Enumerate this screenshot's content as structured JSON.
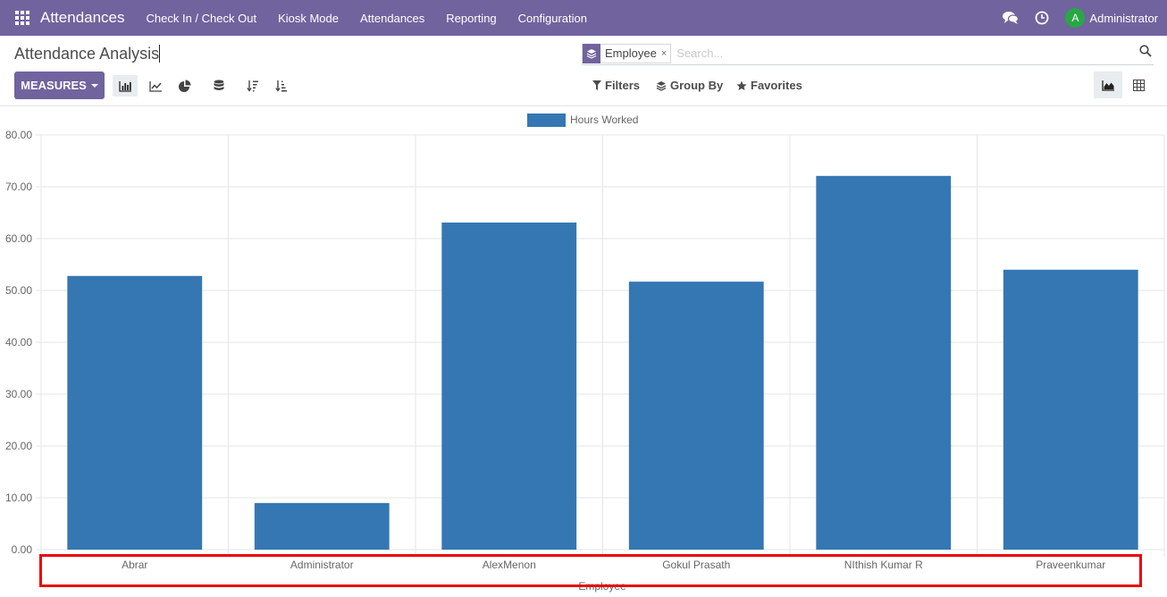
{
  "navbar": {
    "brand": "Attendances",
    "menu": [
      "Check In / Check Out",
      "Kiosk Mode",
      "Attendances",
      "Reporting",
      "Configuration"
    ],
    "user": "Administrator",
    "avatar_letter": "A"
  },
  "control_panel": {
    "title": "Attendance Analysis",
    "measures_label": "MEASURES",
    "search": {
      "facet_value": "Employee",
      "facet_remove": "×",
      "placeholder": "Search..."
    },
    "filters_label": "Filters",
    "groupby_label": "Group By",
    "favorites_label": "Favorites"
  },
  "chart_data": {
    "type": "bar",
    "categories": [
      "Abrar",
      "Administrator",
      "AlexMenon",
      "Gokul Prasath",
      "NIthish Kumar R",
      "Praveenkumar"
    ],
    "series": [
      {
        "name": "Hours Worked",
        "values": [
          52.8,
          9.0,
          63.1,
          51.7,
          72.1,
          54.0
        ],
        "color": "#3577b3"
      }
    ],
    "y_ticks": [
      "0.00",
      "10.00",
      "20.00",
      "30.00",
      "40.00",
      "50.00",
      "60.00",
      "70.00",
      "80.00"
    ],
    "ylim": [
      0,
      80
    ],
    "xlabel": "Employee",
    "ylabel": "",
    "legend": "top-center",
    "grid": true
  },
  "colors": {
    "brand": "#71639e",
    "bar": "#3577b3",
    "highlight": "#e8060d"
  }
}
